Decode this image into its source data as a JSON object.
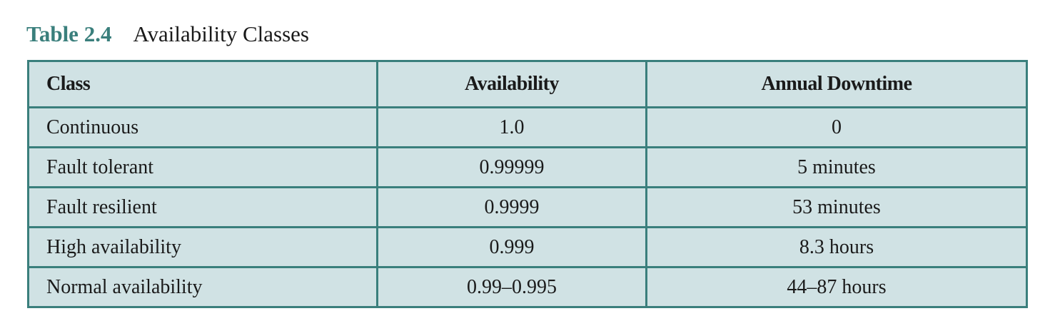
{
  "caption": {
    "number": "Table 2.4",
    "title": "Availability Classes"
  },
  "colors": {
    "accent": "#3a7f7c",
    "cell_fill": "#d0e2e4"
  },
  "table": {
    "headers": [
      "Class",
      "Availability",
      "Annual Downtime"
    ],
    "rows": [
      [
        "Continuous",
        "1.0",
        "0"
      ],
      [
        "Fault tolerant",
        "0.99999",
        "5 minutes"
      ],
      [
        "Fault resilient",
        "0.9999",
        "53 minutes"
      ],
      [
        "High availability",
        "0.999",
        "8.3 hours"
      ],
      [
        "Normal availability",
        "0.99–0.995",
        "44–87 hours"
      ]
    ]
  }
}
